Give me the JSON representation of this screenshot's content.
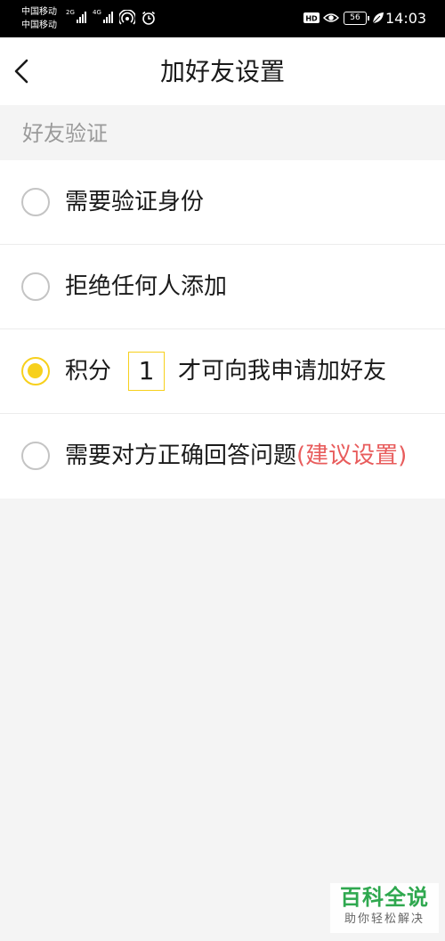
{
  "status_bar": {
    "carrier_1": "中国移动",
    "carrier_2": "中国移动",
    "net_1": "2G",
    "net_2": "4G",
    "battery": "56",
    "time": "14:03",
    "icons": [
      "signal-icon",
      "signal-icon",
      "hotspot-icon",
      "alarm-icon",
      "hd-icon",
      "eye-icon",
      "battery-icon",
      "leaf-icon"
    ]
  },
  "navbar": {
    "title": "加好友设置",
    "back_icon": "chevron-left-icon"
  },
  "section": {
    "label": "好友验证"
  },
  "options": [
    {
      "label": "需要验证身份",
      "selected": false
    },
    {
      "label": "拒绝任何人添加",
      "selected": false
    },
    {
      "label_before": "积分",
      "points_value": "1",
      "label_after": "才可向我申请加好友",
      "selected": true
    },
    {
      "label": "需要对方正确回答问题",
      "hint": "(建议设置)",
      "selected": false
    }
  ],
  "colors": {
    "accent": "#f7d01c",
    "hint": "#e85c5c",
    "background": "#f4f4f4"
  },
  "watermark": {
    "main": "百科全说",
    "sub": "助你轻松解决"
  }
}
